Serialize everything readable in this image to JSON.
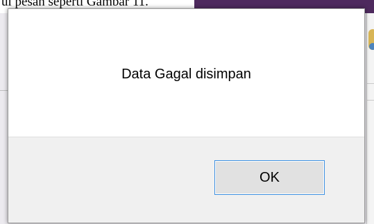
{
  "document": {
    "caption": "ul pesan seperti Gambar 11."
  },
  "dialog": {
    "message": "Data Gagal disimpan",
    "ok_label": "OK"
  },
  "colors": {
    "background_purple": "#4e2a5e",
    "button_focus_border": "#3c8fe0",
    "footer_gray": "#f0f0f0"
  }
}
